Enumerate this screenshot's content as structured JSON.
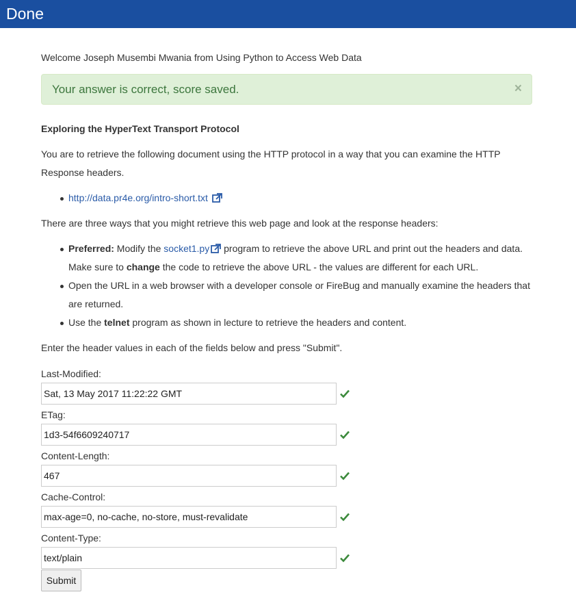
{
  "header": {
    "title": "Done"
  },
  "welcome": "Welcome Joseph Musembi Mwania from Using Python to Access Web Data",
  "alert": {
    "message": "Your answer is correct, score saved.",
    "close": "×"
  },
  "section_title": "Exploring the HyperText Transport Protocol",
  "intro": "You are to retrieve the following document using the HTTP protocol in a way that you can examine the HTTP Response headers.",
  "doc_link": "http://data.pr4e.org/intro-short.txt",
  "ways_intro": "There are three ways that you might retrieve this web page and look at the response headers:",
  "ways": {
    "w1_bold": "Preferred:",
    "w1_pre": " Modify the ",
    "w1_link": "socket1.py",
    "w1_post": " program to retrieve the above URL and print out the headers and data. Make sure to ",
    "w1_bold2": "change",
    "w1_end": " the code to retrieve the above URL - the values are different for each URL.",
    "w2": "Open the URL in a web browser with a developer console or FireBug and manually examine the headers that are returned.",
    "w3_pre": "Use the ",
    "w3_bold": "telnet",
    "w3_post": " program as shown in lecture to retrieve the headers and content."
  },
  "instructions": "Enter the header values in each of the fields below and press \"Submit\".",
  "fields": [
    {
      "label": "Last-Modified:",
      "value": "Sat, 13 May 2017 11:22:22 GMT"
    },
    {
      "label": "ETag:",
      "value": "1d3-54f6609240717"
    },
    {
      "label": "Content-Length:",
      "value": "467"
    },
    {
      "label": "Cache-Control:",
      "value": "max-age=0, no-cache, no-store, must-revalidate"
    },
    {
      "label": "Content-Type:",
      "value": "text/plain"
    }
  ],
  "submit_label": "Submit",
  "colors": {
    "header_bg": "#1a4fa0",
    "success_bg": "#dff0d8",
    "success_text": "#3c763d",
    "link": "#2a5ba8",
    "check": "#3c8a3c"
  },
  "icons": {
    "external": "external-link-icon",
    "check": "check-icon",
    "close": "close-icon"
  }
}
